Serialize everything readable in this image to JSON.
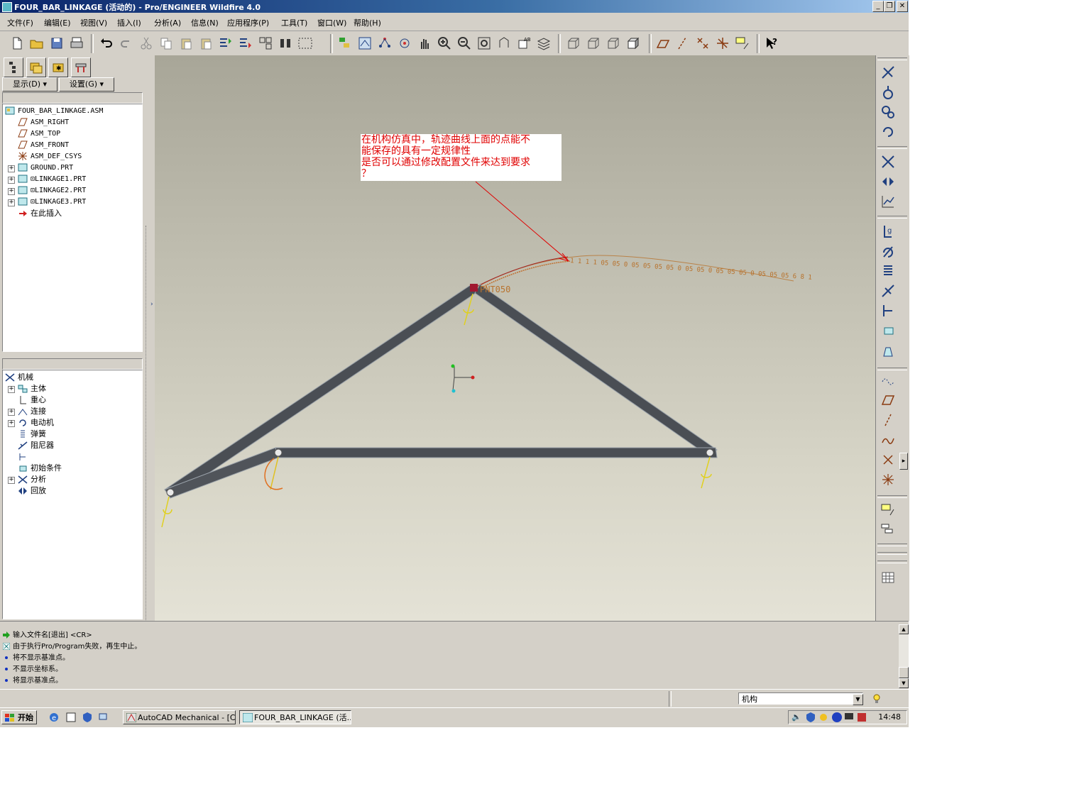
{
  "window": {
    "title": "FOUR_BAR_LINKAGE (活动的) - Pro/ENGINEER Wildfire 4.0"
  },
  "menu": [
    "文件(F)",
    "编辑(E)",
    "视图(V)",
    "插入(I)",
    "分析(A)",
    "信息(N)",
    "应用程序(P)",
    "工具(T)",
    "窗口(W)",
    "帮助(H)"
  ],
  "left_panel": {
    "display_button": "显示(D)",
    "settings_button": "设置(G)",
    "model_tree": [
      {
        "label": "FOUR_BAR_LINKAGE.ASM",
        "icon": "assembly-icon"
      },
      {
        "label": "ASM_RIGHT",
        "icon": "datum-plane-icon"
      },
      {
        "label": "ASM_TOP",
        "icon": "datum-plane-icon"
      },
      {
        "label": "ASM_FRONT",
        "icon": "datum-plane-icon"
      },
      {
        "label": "ASM_DEF_CSYS",
        "icon": "csys-icon"
      },
      {
        "label": "GROUND.PRT",
        "icon": "part-icon"
      },
      {
        "label": "⊡LINKAGE1.PRT",
        "icon": "part-icon"
      },
      {
        "label": "⊡LINKAGE2.PRT",
        "icon": "part-icon"
      },
      {
        "label": "⊡LINKAGE3.PRT",
        "icon": "part-icon"
      },
      {
        "label": "在此插入",
        "icon": "insert-here-arrow-icon"
      }
    ],
    "mechanism_tree": [
      {
        "label": "机械",
        "icon": "mechanism-icon"
      },
      {
        "label": "主体",
        "icon": "bodies-icon"
      },
      {
        "label": "重心",
        "icon": "gravity-icon"
      },
      {
        "label": "连接",
        "icon": "connections-icon"
      },
      {
        "label": "电动机",
        "icon": "motor-icon"
      },
      {
        "label": "弹簧",
        "icon": "spring-icon"
      },
      {
        "label": "阻尼器",
        "icon": "damper-icon"
      },
      {
        "label": "",
        "icon": "force-icon"
      },
      {
        "label": "初始条件",
        "icon": "initial-conditions-icon"
      },
      {
        "label": "分析",
        "icon": "analysis-icon"
      },
      {
        "label": "回放",
        "icon": "playback-icon"
      }
    ]
  },
  "viewport": {
    "annotation_lines": [
      "在机构仿真中，轨迹曲线上面的点能不",
      "能保存的具有一定规律性",
      "是否可以通过修改配置文件来达到要求",
      "？"
    ],
    "point_label": "PNT050",
    "trace_text": "1 1 1 1 05 05 0 05 05 05 05 0 05 05 0 05 05 05 0 05 05 05 6 8 1"
  },
  "messages": [
    {
      "text": "输入文件名[退出]    <CR>",
      "icon": "prompt-arrow-icon"
    },
    {
      "text": "由于执行Pro/Program失败，再生中止。",
      "icon": "error-icon"
    },
    {
      "text": "将不显示基准点。",
      "icon": "info-bullet-icon"
    },
    {
      "text": "不显示坐标系。",
      "icon": "info-bullet-icon"
    },
    {
      "text": "将显示基准点。",
      "icon": "info-bullet-icon"
    }
  ],
  "status": {
    "mode": "机构"
  },
  "taskbar": {
    "start": "开始",
    "items": [
      "AutoCAD Mechanical - [C:...",
      "FOUR_BAR_LINKAGE (活..."
    ],
    "clock": "14:48"
  },
  "colors": {
    "annotation_text": "#e00000",
    "link_color": "#4a4e54",
    "trace_color": "#b8732e",
    "title_bar": "#0a246a"
  }
}
